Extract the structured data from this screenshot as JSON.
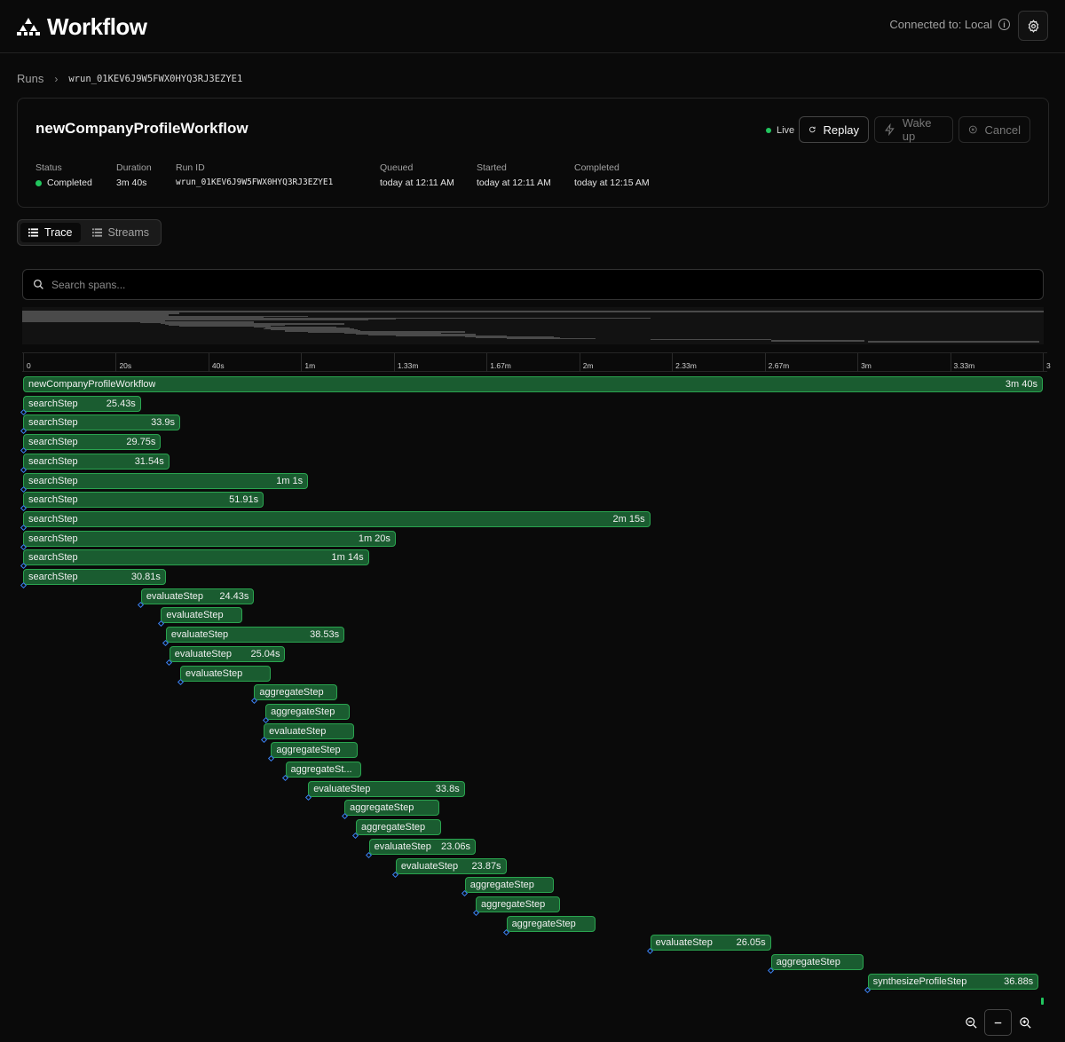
{
  "header": {
    "brand": "Workflow",
    "connection_label": "Connected to: Local"
  },
  "breadcrumb": {
    "root": "Runs",
    "current": "wrun_01KEV6J9W5FWX0HYQ3RJ3EZYE1"
  },
  "run": {
    "title": "newCompanyProfileWorkflow",
    "live_label": "Live",
    "replay_label": "Replay",
    "wake_label": "Wake up",
    "cancel_label": "Cancel",
    "status_label": "Status",
    "status_value": "Completed",
    "duration_label": "Duration",
    "duration_value": "3m 40s",
    "runid_label": "Run ID",
    "runid_value": "wrun_01KEV6J9W5FWX0HYQ3RJ3EZYE1",
    "queued_label": "Queued",
    "queued_value": "today at 12:11 AM",
    "started_label": "Started",
    "started_value": "today at 12:11 AM",
    "completed_label": "Completed",
    "completed_value": "today at 12:15 AM"
  },
  "tabs": [
    {
      "label": "Trace",
      "active": true
    },
    {
      "label": "Streams",
      "active": false
    }
  ],
  "search": {
    "placeholder": "Search spans..."
  },
  "timeline": {
    "total_seconds": 220,
    "ticks": [
      {
        "label": "0",
        "t": 0
      },
      {
        "label": "20s",
        "t": 20
      },
      {
        "label": "40s",
        "t": 40
      },
      {
        "label": "1m",
        "t": 60
      },
      {
        "label": "1.33m",
        "t": 80
      },
      {
        "label": "1.67m",
        "t": 100
      },
      {
        "label": "2m",
        "t": 120
      },
      {
        "label": "2.33m",
        "t": 140
      },
      {
        "label": "2.67m",
        "t": 160
      },
      {
        "label": "3m",
        "t": 180
      },
      {
        "label": "3.33m",
        "t": 200
      },
      {
        "label": "3",
        "t": 220
      }
    ],
    "spans": [
      {
        "name": "newCompanyProfileWorkflow",
        "duration": "3m 40s",
        "start": 0,
        "length": 220
      },
      {
        "name": "searchStep",
        "duration": "25.43s",
        "start": 0,
        "length": 25.43
      },
      {
        "name": "searchStep",
        "duration": "33.9s",
        "start": 0,
        "length": 33.9
      },
      {
        "name": "searchStep",
        "duration": "29.75s",
        "start": 0,
        "length": 29.75
      },
      {
        "name": "searchStep",
        "duration": "31.54s",
        "start": 0,
        "length": 31.54
      },
      {
        "name": "searchStep",
        "duration": "1m 1s",
        "start": 0,
        "length": 61.5
      },
      {
        "name": "searchStep",
        "duration": "51.91s",
        "start": 0,
        "length": 51.91
      },
      {
        "name": "searchStep",
        "duration": "2m 15s",
        "start": 0,
        "length": 135.3
      },
      {
        "name": "searchStep",
        "duration": "1m 20s",
        "start": 0,
        "length": 80.4
      },
      {
        "name": "searchStep",
        "duration": "1m 14s",
        "start": 0,
        "length": 74.6
      },
      {
        "name": "searchStep",
        "duration": "30.81s",
        "start": 0,
        "length": 30.81
      },
      {
        "name": "evaluateStep",
        "duration": "24.43s",
        "start": 25.43,
        "length": 24.43
      },
      {
        "name": "evaluateStep",
        "duration": "",
        "start": 29.75,
        "length": 17.6
      },
      {
        "name": "evaluateStep",
        "duration": "38.53s",
        "start": 30.81,
        "length": 38.53
      },
      {
        "name": "evaluateStep",
        "duration": "25.04s",
        "start": 31.54,
        "length": 25.04
      },
      {
        "name": "evaluateStep",
        "duration": "",
        "start": 33.9,
        "length": 19.6
      },
      {
        "name": "aggregateStep",
        "duration": "",
        "start": 49.86,
        "length": 17.9
      },
      {
        "name": "aggregateStep",
        "duration": "",
        "start": 52.3,
        "length": 18.2
      },
      {
        "name": "evaluateStep",
        "duration": "",
        "start": 51.91,
        "length": 19.6
      },
      {
        "name": "aggregateStep",
        "duration": "",
        "start": 53.5,
        "length": 18.7
      },
      {
        "name": "aggregateSt...",
        "duration": "",
        "start": 56.58,
        "length": 16.3
      },
      {
        "name": "evaluateStep",
        "duration": "33.8s",
        "start": 61.5,
        "length": 33.8
      },
      {
        "name": "aggregateStep",
        "duration": "",
        "start": 69.34,
        "length": 20.5
      },
      {
        "name": "aggregateStep",
        "duration": "",
        "start": 71.8,
        "length": 18.4
      },
      {
        "name": "evaluateStep",
        "duration": "23.06s",
        "start": 74.6,
        "length": 23.06
      },
      {
        "name": "evaluateStep",
        "duration": "23.87s",
        "start": 80.4,
        "length": 23.87
      },
      {
        "name": "aggregateStep",
        "duration": "",
        "start": 95.3,
        "length": 19.2
      },
      {
        "name": "aggregateStep",
        "duration": "",
        "start": 97.66,
        "length": 18.2
      },
      {
        "name": "aggregateStep",
        "duration": "",
        "start": 104.27,
        "length": 19.3
      },
      {
        "name": "evaluateStep",
        "duration": "26.05s",
        "start": 135.3,
        "length": 26.05
      },
      {
        "name": "aggregateStep",
        "duration": "",
        "start": 161.35,
        "length": 20.0
      },
      {
        "name": "synthesizeProfileStep",
        "duration": "36.88s",
        "start": 182.2,
        "length": 36.88
      }
    ]
  },
  "colors": {
    "span_fill": "#1a5c30",
    "span_border": "#2aa44f",
    "status_ok": "#22c55e",
    "anchor": "#3b82f6"
  }
}
